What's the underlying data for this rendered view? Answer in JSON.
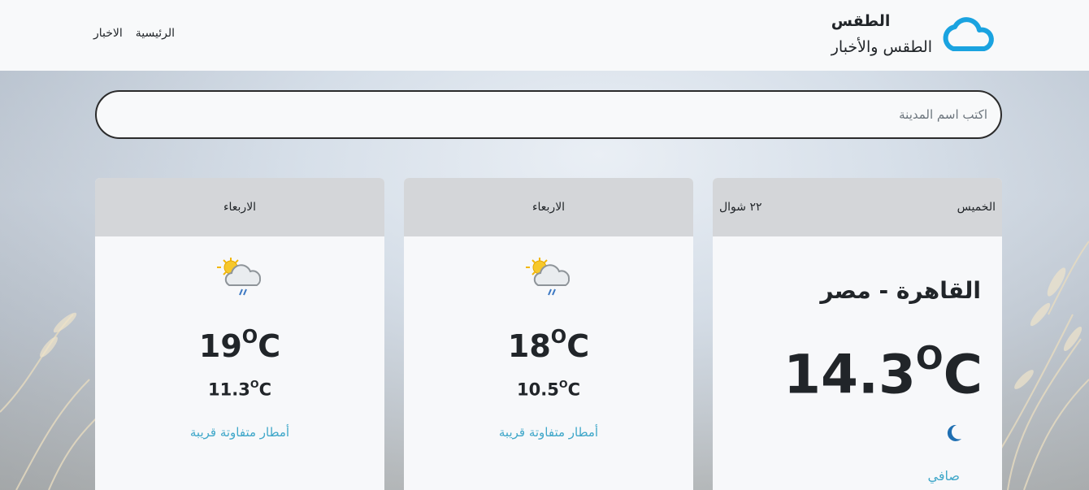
{
  "header": {
    "brand_title": "الطقس",
    "brand_subtitle": "الطقس والأخبار",
    "nav": [
      "الرئيسية",
      "الاخبار"
    ]
  },
  "search": {
    "placeholder": "اكتب اسم المدينة"
  },
  "today": {
    "day": "الخميس",
    "date": "٢٢ شوال",
    "location": "القاهرة - مصر",
    "temp": "14.3",
    "unit_o": "O",
    "unit_c": "C",
    "icon": "moon-icon",
    "condition": "صافي"
  },
  "forecast": [
    {
      "day": "الاربعاء",
      "icon": "sun-cloud-rain-icon",
      "max": "18",
      "min": "10.5",
      "unit_o": "O",
      "unit_c": "C",
      "condition": "أمطار متفاوتة قريبة"
    },
    {
      "day": "الاربعاء",
      "icon": "sun-cloud-rain-icon",
      "max": "19",
      "min": "11.3",
      "unit_o": "O",
      "unit_c": "C",
      "condition": "أمطار متفاوتة قريبة"
    }
  ],
  "colors": {
    "accent": "#3fa7c9",
    "logo": "#1aa3e0",
    "header_bg": "#f8f9fa",
    "card_head": "#d4d6d9",
    "moon": "#1f6fb2"
  }
}
